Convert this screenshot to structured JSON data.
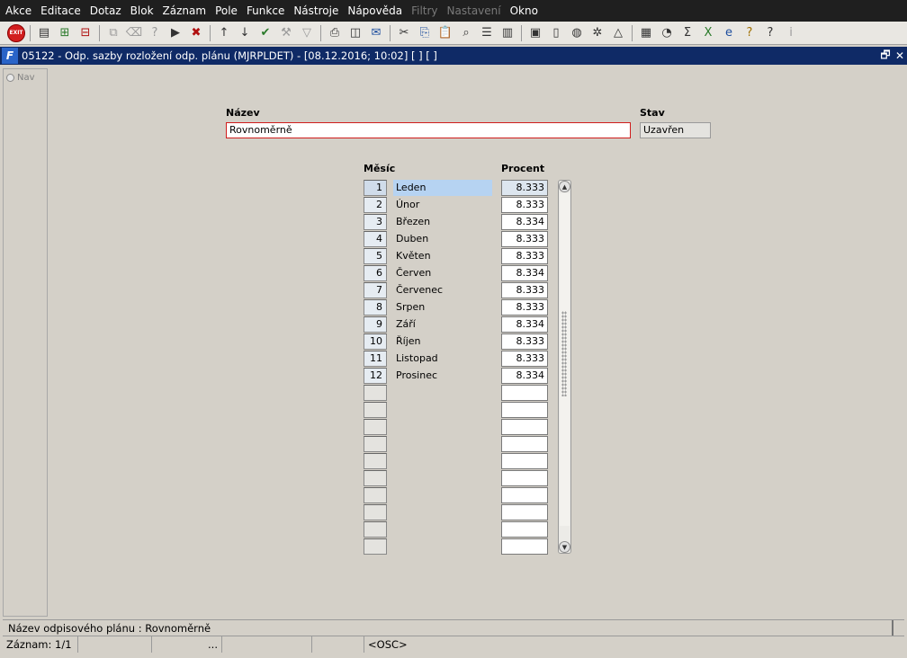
{
  "menu": [
    "Akce",
    "Editace",
    "Dotaz",
    "Blok",
    "Záznam",
    "Pole",
    "Funkce",
    "Nástroje",
    "Nápověda",
    "Filtry",
    "Nastavení",
    "Okno"
  ],
  "menu_disabled": [
    "Filtry",
    "Nastavení"
  ],
  "toolbar": {
    "exit_label": "EXIT",
    "icons": [
      "exit-icon",
      "save-icon",
      "insert-record-icon",
      "delete-record-icon",
      "duplicate-icon",
      "clear-icon",
      "query-icon",
      "execute-query-icon",
      "cancel-query-icon",
      "sort-asc-icon",
      "sort-desc-icon",
      "commit-check-icon",
      "tools-icon",
      "filter-icon",
      "print-icon",
      "print-preview-icon",
      "mail-icon",
      "cut-icon",
      "copy-icon",
      "paste-icon",
      "find-icon",
      "indent-icon",
      "columns-icon",
      "attach-icon",
      "document-icon",
      "globe-icon",
      "settings-wheel-icon",
      "triangle-icon",
      "chart-icon",
      "dial-icon",
      "sigma-icon",
      "excel-icon",
      "ie-icon",
      "help-context-icon",
      "help-icon",
      "info-icon"
    ]
  },
  "window": {
    "logo": "F",
    "title": "05122 - Odp. sazby rozložení odp. plánu (MJRPLDET) - [08.12.2016; 10:02]  [ ] [ ]",
    "restore_glyph": "🗗",
    "close_glyph": "✕"
  },
  "nav": {
    "label": "Nav"
  },
  "form": {
    "nazev_label": "Název",
    "nazev_value": "Rovnoměrně",
    "stav_label": "Stav",
    "stav_value": "Uzavřen",
    "mesic_label": "Měsíc",
    "procent_label": "Procent",
    "rows": [
      {
        "num": "1",
        "name": "Leden",
        "pct": "8.333"
      },
      {
        "num": "2",
        "name": "Únor",
        "pct": "8.333"
      },
      {
        "num": "3",
        "name": "Březen",
        "pct": "8.334"
      },
      {
        "num": "4",
        "name": "Duben",
        "pct": "8.333"
      },
      {
        "num": "5",
        "name": "Květen",
        "pct": "8.333"
      },
      {
        "num": "6",
        "name": "Červen",
        "pct": "8.334"
      },
      {
        "num": "7",
        "name": "Červenec",
        "pct": "8.333"
      },
      {
        "num": "8",
        "name": "Srpen",
        "pct": "8.333"
      },
      {
        "num": "9",
        "name": "Září",
        "pct": "8.334"
      },
      {
        "num": "10",
        "name": "Říjen",
        "pct": "8.333"
      },
      {
        "num": "11",
        "name": "Listopad",
        "pct": "8.333"
      },
      {
        "num": "12",
        "name": "Prosinec",
        "pct": "8.334"
      }
    ],
    "empty_rows": 10
  },
  "status": {
    "line1": "Název odpisového plánu : Rovnoměrně",
    "record": "Záznam: 1/1",
    "ellipsis": "...",
    "mode": "<OSC>"
  }
}
